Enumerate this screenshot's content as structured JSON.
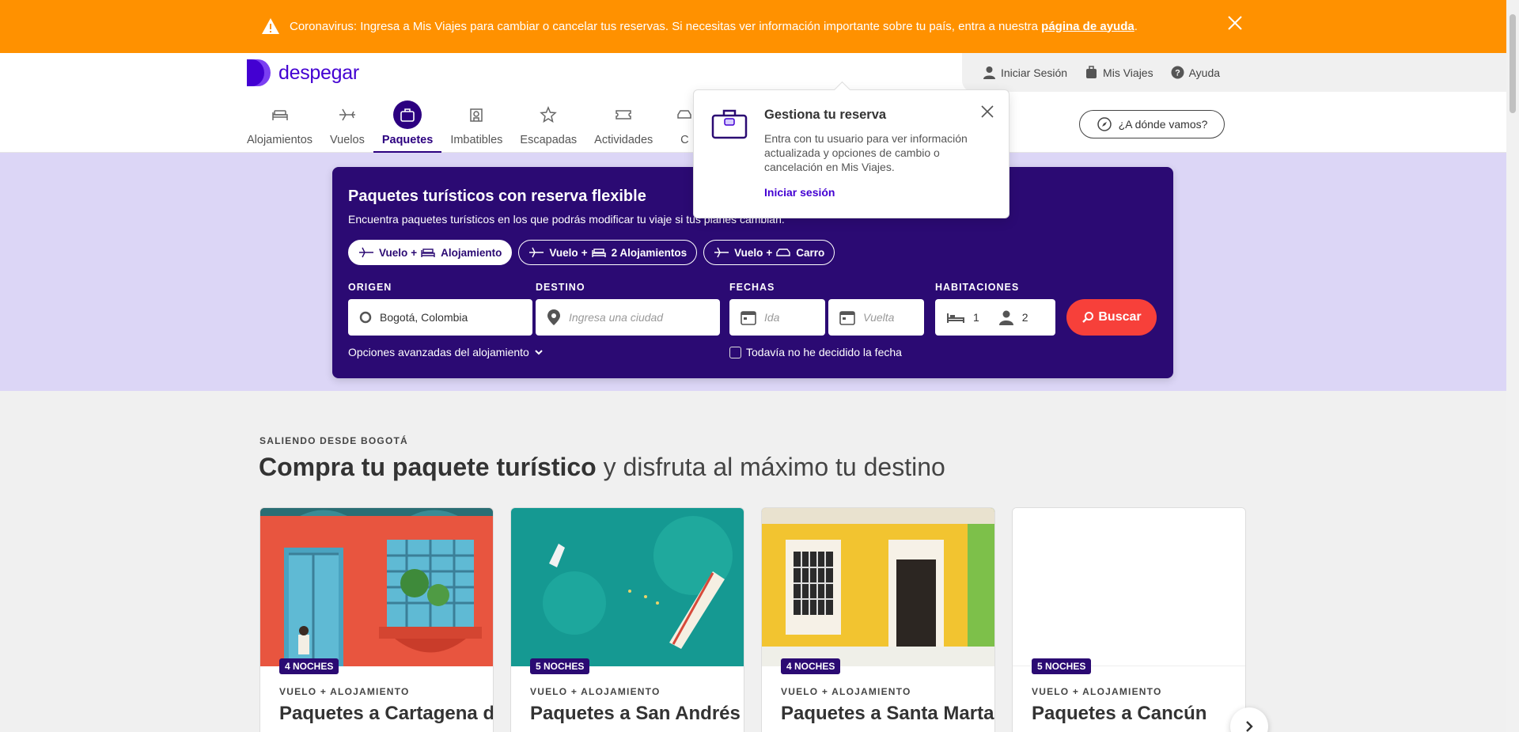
{
  "alert": {
    "text": "Coronavirus: Ingresa a Mis Viajes para cambiar o cancelar tus reservas. Si necesitas ver información importante sobre tu país, entra a nuestra ",
    "link": "página de ayuda",
    "suffix": "."
  },
  "brand": {
    "name": "despegar",
    "color": "#4300d2"
  },
  "top_links": {
    "login": "Iniciar Sesión",
    "trips": "Mis Viajes",
    "help": "Ayuda"
  },
  "nav": [
    {
      "label": "Alojamientos",
      "icon": "bed-icon"
    },
    {
      "label": "Vuelos",
      "icon": "plane-icon"
    },
    {
      "label": "Paquetes",
      "icon": "suitcase-icon",
      "active": true
    },
    {
      "label": "Imbatibles",
      "icon": "hotel-badge-icon"
    },
    {
      "label": "Escapadas",
      "icon": "star-icon"
    },
    {
      "label": "Actividades",
      "icon": "ticket-icon"
    },
    {
      "label": "C",
      "icon": "car-icon"
    }
  ],
  "where_button": "¿A dónde vamos?",
  "popover": {
    "title": "Gestiona tu reserva",
    "body": "Entra con tu usuario para ver información actualizada y opciones de cambio o cancelación en Mis Viajes.",
    "link": "Iniciar sesión"
  },
  "search": {
    "title": "Paquetes turísticos con reserva flexible",
    "subtitle": "Encuentra paquetes turísticos en los que podrás modificar tu viaje si tus planes cambian.",
    "pills": [
      {
        "a": "Vuelo",
        "plus": "+",
        "b": "Alojamiento",
        "active": true
      },
      {
        "a": "Vuelo",
        "plus": "+",
        "b": "2 Alojamientos"
      },
      {
        "a": "Vuelo",
        "plus": "+",
        "b": "Carro"
      }
    ],
    "origin_label": "ORIGEN",
    "origin_value": "Bogotá, Colombia",
    "destination_label": "DESTINO",
    "destination_placeholder": "Ingresa una ciudad",
    "dates_label": "FECHAS",
    "depart_placeholder": "Ida",
    "return_placeholder": "Vuelta",
    "rooms_label": "HABITACIONES",
    "rooms": "1",
    "guests": "2",
    "search_button": "Buscar",
    "advanced": "Opciones avanzadas del alojamiento",
    "undecided": "Todavía no he decidido la fecha"
  },
  "section": {
    "eyebrow": "SALIENDO DESDE BOGOTÁ",
    "headline_bold": "Compra tu paquete turístico",
    "headline_rest": " y disfruta al máximo tu destino"
  },
  "cards": [
    {
      "badge": "4 NOCHES",
      "type": "VUELO + ALOJAMIENTO",
      "title": "Paquetes a Cartagena de Indias"
    },
    {
      "badge": "5 NOCHES",
      "type": "VUELO + ALOJAMIENTO",
      "title": "Paquetes a San Andrés"
    },
    {
      "badge": "4 NOCHES",
      "type": "VUELO + ALOJAMIENTO",
      "title": "Paquetes a Santa Marta"
    },
    {
      "badge": "5 NOCHES",
      "type": "VUELO + ALOJAMIENTO",
      "title": "Paquetes a Cancún"
    }
  ]
}
